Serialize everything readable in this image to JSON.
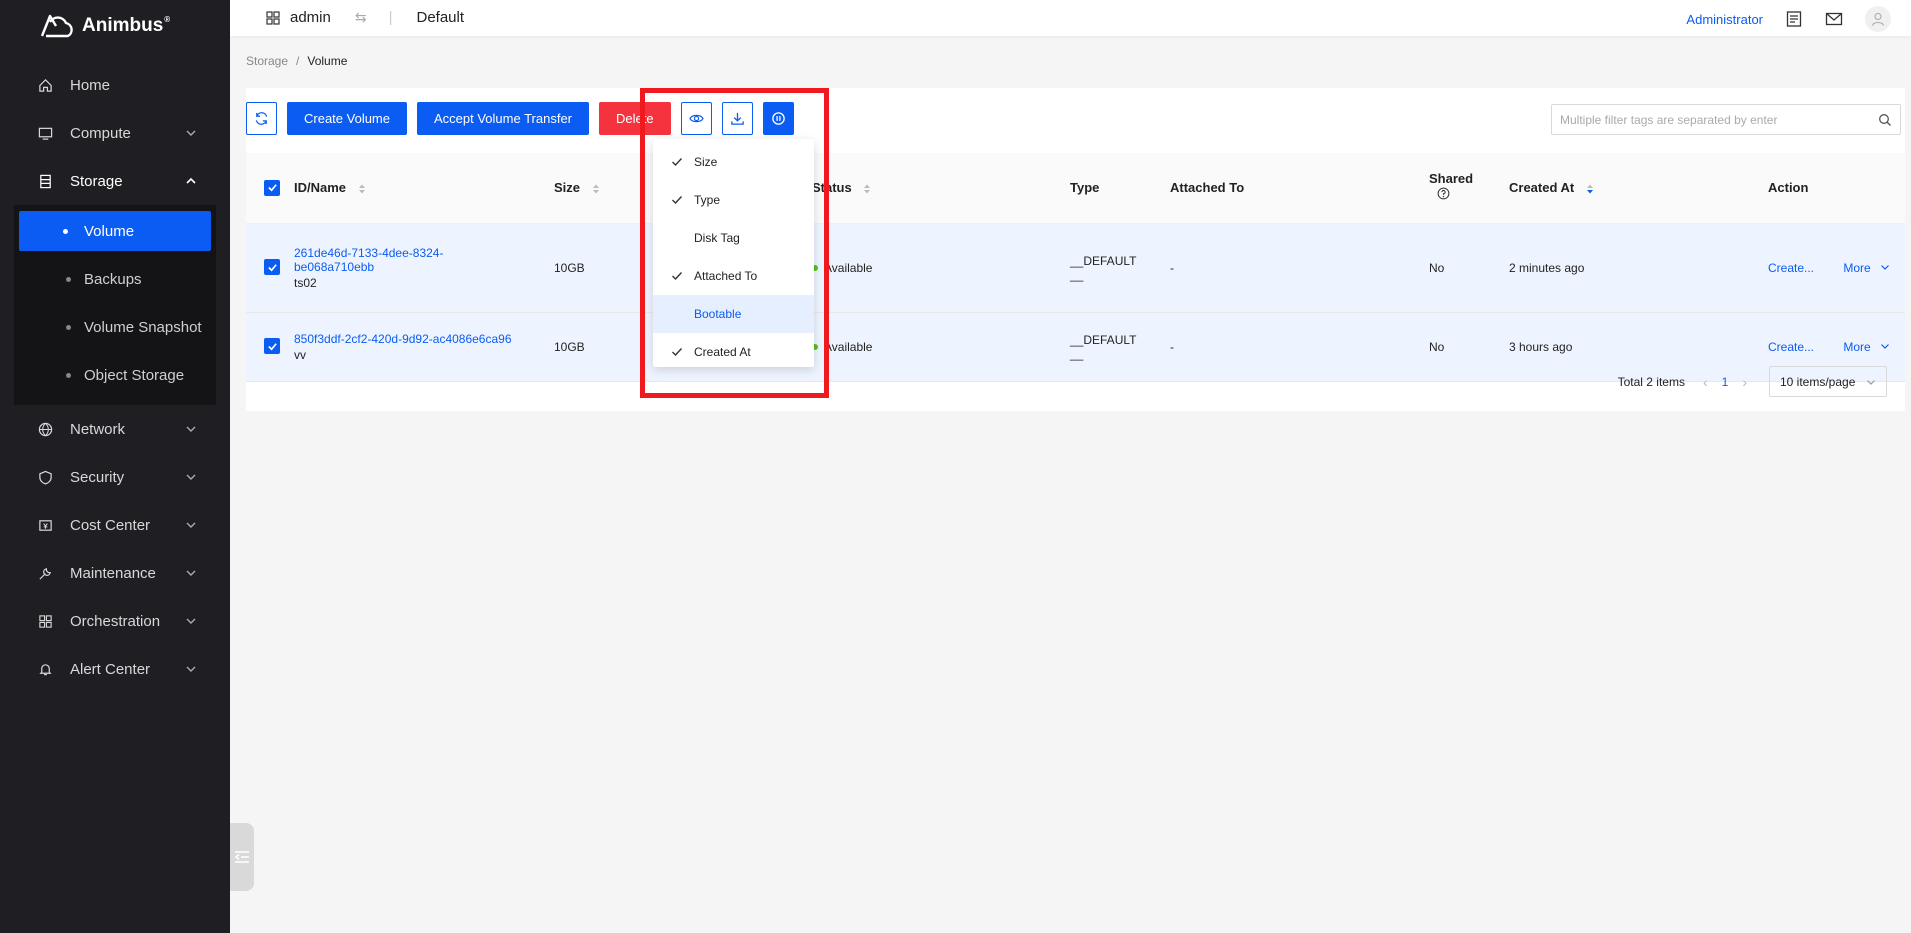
{
  "brand": {
    "name": "Animbus",
    "reg": "®"
  },
  "sidebar": {
    "items": [
      {
        "label": "Home",
        "icon": "home-icon"
      },
      {
        "label": "Compute",
        "icon": "monitor-icon"
      },
      {
        "label": "Storage",
        "icon": "storage-icon"
      },
      {
        "label": "Network",
        "icon": "globe-icon"
      },
      {
        "label": "Security",
        "icon": "shield-icon"
      },
      {
        "label": "Cost Center",
        "icon": "wallet-icon"
      },
      {
        "label": "Maintenance",
        "icon": "wrench-icon"
      },
      {
        "label": "Orchestration",
        "icon": "grid-icon"
      },
      {
        "label": "Alert Center",
        "icon": "bell-icon"
      }
    ],
    "storage_sub": [
      {
        "label": "Volume"
      },
      {
        "label": "Backups"
      },
      {
        "label": "Volume Snapshot"
      },
      {
        "label": "Object Storage"
      }
    ]
  },
  "header": {
    "user": "admin",
    "project": "Default",
    "role": "Administrator"
  },
  "breadcrumb": {
    "parent": "Storage",
    "sep": "/",
    "current": "Volume"
  },
  "toolbar": {
    "create_label": "Create Volume",
    "accept_label": "Accept Volume Transfer",
    "delete_label": "Delete"
  },
  "search": {
    "placeholder": "Multiple filter tags are separated by enter"
  },
  "table": {
    "headers": {
      "id_name": "ID/Name",
      "size": "Size",
      "status": "Status",
      "type": "Type",
      "attached": "Attached To",
      "shared": "Shared",
      "created": "Created At",
      "action": "Action"
    },
    "rows": [
      {
        "id_line1": "261de46d-7133-4dee-8324-",
        "id_line2": "be068a710ebb",
        "name": "ts02",
        "size": "10GB",
        "status": "Available",
        "type_line1": "__DEFAULT",
        "type_line2": "__",
        "attached": "-",
        "shared": "No",
        "created": "2 minutes ago",
        "action": "Create...",
        "more": "More"
      },
      {
        "id_line1": "850f3ddf-2cf2-420d-9d92-ac4086e6ca96",
        "id_line2": "",
        "name": "vv",
        "size": "10GB",
        "status": "Available",
        "type_line1": "__DEFAULT",
        "type_line2": "__",
        "attached": "-",
        "shared": "No",
        "created": "3 hours ago",
        "action": "Create...",
        "more": "More"
      }
    ]
  },
  "pagination": {
    "total": "Total 2 items",
    "current": "1",
    "page_size": "10 items/page"
  },
  "column_menu": {
    "items": [
      {
        "label": "Size",
        "checked": true
      },
      {
        "label": "Type",
        "checked": true
      },
      {
        "label": "Disk Tag",
        "checked": false
      },
      {
        "label": "Attached To",
        "checked": true
      },
      {
        "label": "Bootable",
        "checked": false
      },
      {
        "label": "Created At",
        "checked": true
      }
    ]
  },
  "colors": {
    "primary": "#0a5cf2",
    "danger": "#f5333f",
    "highlight": "#f0191e",
    "sidebar": "#1f1f23"
  }
}
